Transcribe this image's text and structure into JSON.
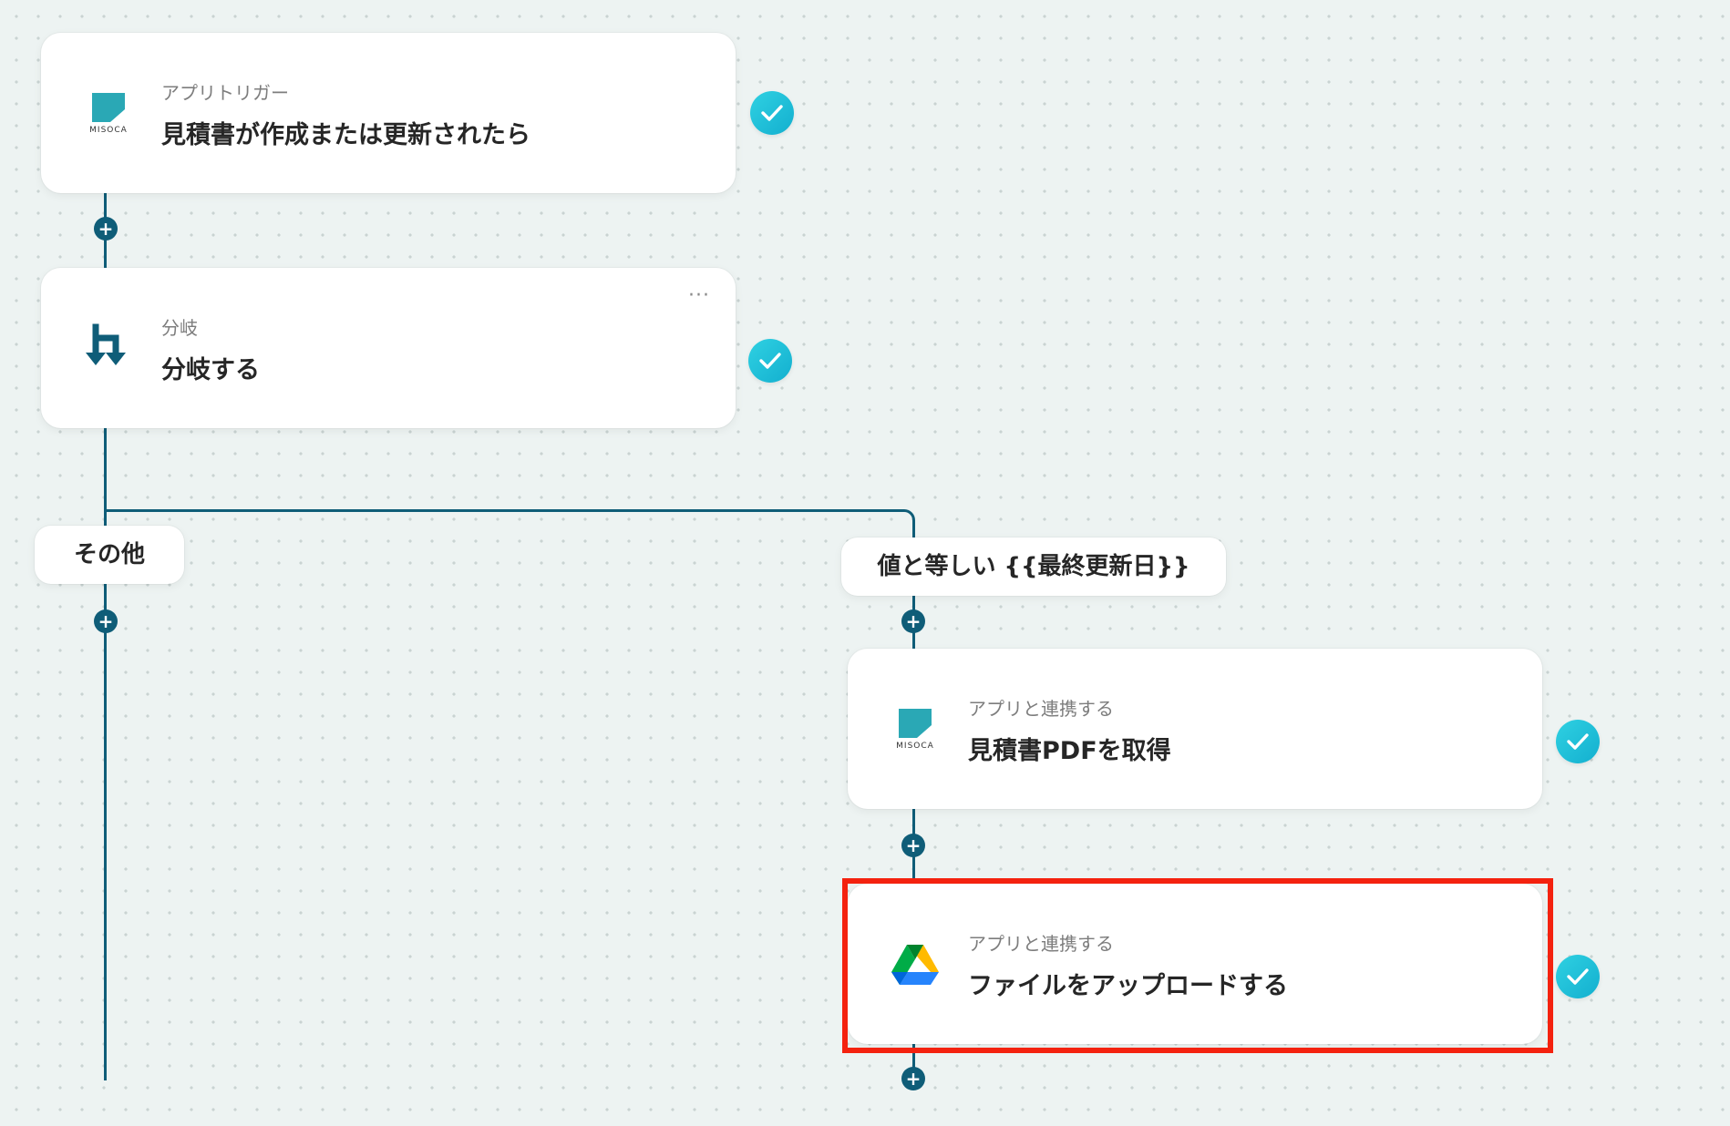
{
  "flow": {
    "trigger": {
      "sub_label": "アプリトリガー",
      "title": "見積書が作成または更新されたら",
      "logo_text": "MISOCA",
      "icon": "misoca-logo"
    },
    "branch": {
      "sub_label": "分岐",
      "title": "分岐する",
      "icon": "branch-icon",
      "more_label": "···"
    },
    "branch_other": {
      "label": "その他"
    },
    "branch_condition": {
      "label": "値と等しい {{最終更新日}}"
    },
    "get_pdf": {
      "sub_label": "アプリと連携する",
      "title": "見積書PDFを取得",
      "logo_text": "MISOCA",
      "icon": "misoca-logo"
    },
    "upload": {
      "sub_label": "アプリと連携する",
      "title": "ファイルをアップロードする",
      "icon": "google-drive-logo"
    },
    "add_step_symbol": "+"
  },
  "colors": {
    "connector": "#0f5d78",
    "check": "#1ec1d8",
    "highlight": "#f4220f",
    "misoca_teal": "#2aa8b5"
  }
}
